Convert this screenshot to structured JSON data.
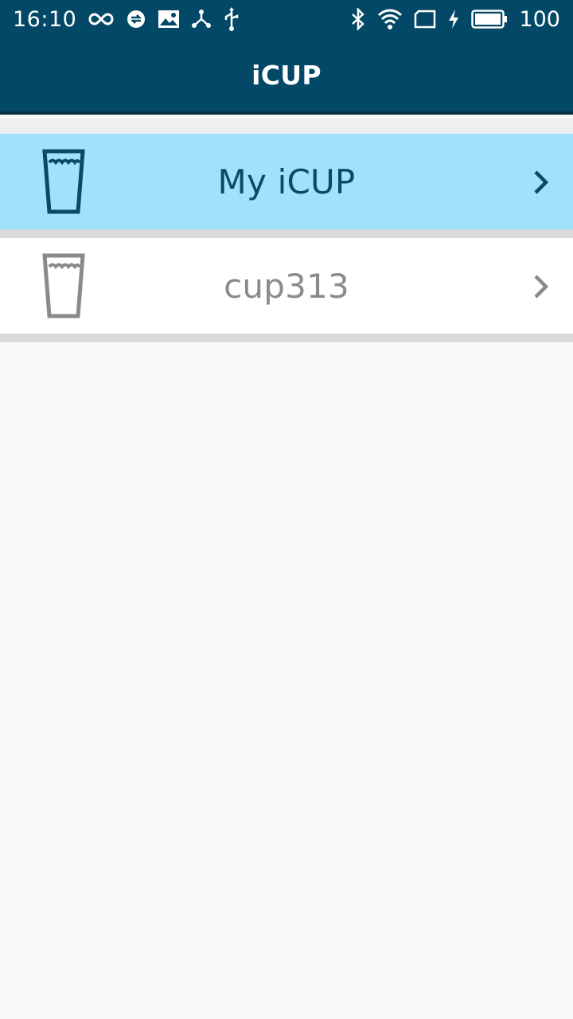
{
  "status_bar": {
    "time": "16:10",
    "battery_level": "100",
    "left_icons": [
      "infinity-icon",
      "sync-icon",
      "image-icon",
      "share-nodes-icon",
      "usb-icon"
    ],
    "right_icons": [
      "bluetooth-icon",
      "wifi-icon",
      "screen-icon",
      "charging-icon",
      "battery-icon"
    ]
  },
  "app_bar": {
    "title": "iCUP"
  },
  "list": {
    "items": [
      {
        "label": "My iCUP",
        "icon": "cup-icon",
        "selected": true,
        "accent": "#0b4a66"
      },
      {
        "label": "cup313",
        "icon": "cup-icon",
        "selected": false,
        "accent": "#8a8a8a"
      }
    ]
  },
  "colors": {
    "primary": "#034866",
    "selected_row": "#a0e1fb",
    "divider": "#dadada",
    "background": "#f8f8f8"
  }
}
